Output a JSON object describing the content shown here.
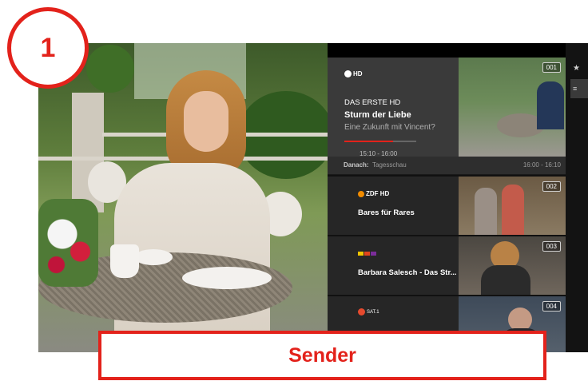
{
  "step_badge": "1",
  "caption": "Sender",
  "colors": {
    "accent": "#e3221b",
    "panel": "#1a1a1a",
    "active_row": "#3a3a3a"
  },
  "channels": [
    {
      "number": "001",
      "logo": "HD",
      "name": "DAS ERSTE HD",
      "show": "Sturm der Liebe",
      "episode": "Eine Zukunft mit Vincent?",
      "time": "15:10 - 16:00",
      "progress": 0.68,
      "next_label": "Danach:",
      "next_show": "Tagesschau",
      "next_time": "16:00 - 16:10"
    },
    {
      "number": "002",
      "logo": "ZDF HD",
      "show": "Bares für Rares"
    },
    {
      "number": "003",
      "logo": "RTL",
      "show": "Barbara Salesch - Das Str..."
    },
    {
      "number": "004",
      "logo": "SAT.1"
    }
  ],
  "sidebar": {
    "icons": [
      "star-icon",
      "list-icon"
    ]
  }
}
